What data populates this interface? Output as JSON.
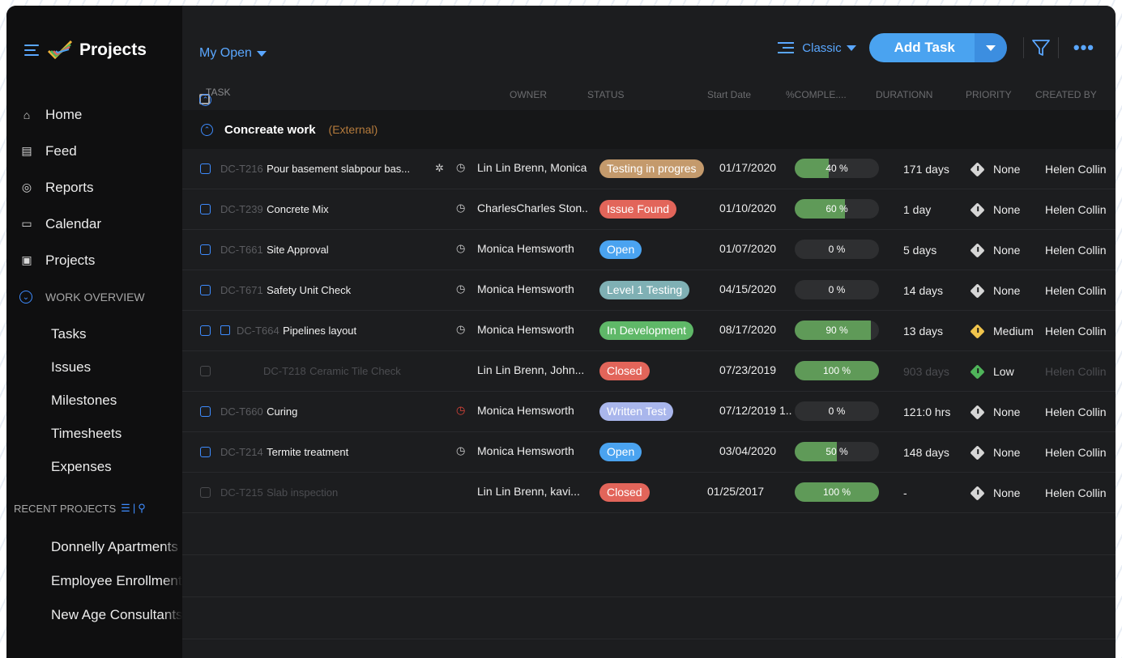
{
  "sidebar": {
    "brand": "Projects",
    "nav": [
      {
        "label": "Home",
        "icon": "home-icon"
      },
      {
        "label": "Feed",
        "icon": "feed-icon"
      },
      {
        "label": "Reports",
        "icon": "reports-icon"
      },
      {
        "label": "Calendar",
        "icon": "calendar-icon"
      },
      {
        "label": "Projects",
        "icon": "projects-icon"
      }
    ],
    "work_overview": "WORK OVERVIEW",
    "work_items": [
      "Tasks",
      "Issues",
      "Milestones",
      "Timesheets",
      "Expenses"
    ],
    "recent_projects_label": "RECENT PROJECTS",
    "recent_projects": [
      "Donnelly Apartments",
      "Employee Enrollment",
      "New Age Consultants"
    ]
  },
  "toolbar": {
    "view": "My Open",
    "layout": "Classic",
    "add_task": "Add Task"
  },
  "columns": {
    "task": "TASK",
    "owner": "OWNER",
    "status": "STATUS",
    "start_date": "Start Date",
    "complete": "%COMPLE....",
    "duration": "DURATIONN",
    "priority": "PRIORITY",
    "created_by": "CREATED BY"
  },
  "group": {
    "name": "Concreate work",
    "tag": "(External)"
  },
  "colors": {
    "accent": "#4aa3f0",
    "progress": "#5f9a58",
    "status_testing": "#c49a6c",
    "status_issue": "#e2655a",
    "status_open": "#4aa3f0",
    "status_level1": "#7fb0b4",
    "status_dev": "#5fb868",
    "status_closed": "#e2655a",
    "status_written": "#a9b6ec",
    "prio_none": "#d6d6d6",
    "prio_medium": "#f0c44c",
    "prio_low": "#4fb55a"
  },
  "rows": [
    {
      "id": "DC-T216",
      "name": "Pour basement slabpour bas...",
      "owner": "Lin Lin Brenn, Monica",
      "status": "Testing in progres",
      "status_color": "#c49a6c",
      "start": "01/17/2020",
      "pct": "40 %",
      "pct_value": 40,
      "duration": "171 days",
      "priority": "None",
      "priority_color": "#d6d6d6",
      "creator": "Helen Collin",
      "dim": false,
      "bug": true,
      "timer": "normal"
    },
    {
      "id": "DC-T239",
      "name": "Concrete Mix",
      "owner": "CharlesCharles Ston..",
      "status": "Issue Found",
      "status_color": "#e2655a",
      "start": "01/10/2020",
      "pct": "60 %",
      "pct_value": 60,
      "duration": "1 day",
      "priority": "None",
      "priority_color": "#d6d6d6",
      "creator": "Helen Collin",
      "dim": false,
      "bug": false,
      "timer": "normal"
    },
    {
      "id": "DC-T661",
      "name": "Site Approval",
      "owner": "Monica Hemsworth",
      "status": "Open",
      "status_color": "#4aa3f0",
      "start": "01/07/2020",
      "pct": "0 %",
      "pct_value": 0,
      "duration": "5 days",
      "priority": "None",
      "priority_color": "#d6d6d6",
      "creator": "Helen Collin",
      "dim": false,
      "bug": false,
      "timer": "normal"
    },
    {
      "id": "DC-T671",
      "name": "Safety Unit Check",
      "owner": "Monica Hemsworth",
      "status": "Level 1 Testing",
      "status_color": "#7fb0b4",
      "start": "04/15/2020",
      "pct": "0 %",
      "pct_value": 0,
      "duration": "14 days",
      "priority": "None",
      "priority_color": "#d6d6d6",
      "creator": "Helen Collin",
      "dim": false,
      "bug": false,
      "timer": "normal"
    },
    {
      "id": "DC-T664",
      "name": "Pipelines layout",
      "owner": "Monica Hemsworth",
      "status": "In Development",
      "status_color": "#5fb868",
      "start": "08/17/2020",
      "pct": "90 %",
      "pct_value": 90,
      "duration": "13 days",
      "priority": "Medium",
      "priority_color": "#f0c44c",
      "creator": "Helen Collin",
      "dim": false,
      "bug": false,
      "timer": "normal",
      "subtask": true
    },
    {
      "id": "DC-T218",
      "name": "Ceramic Tile Check",
      "owner": "Lin Lin Brenn, John...",
      "status": "Closed",
      "status_color": "#e2655a",
      "start": "07/23/2019",
      "pct": "100 %",
      "pct_value": 100,
      "duration": "903 days",
      "priority": "Low",
      "priority_color": "#4fb55a",
      "creator": "Helen Collin",
      "dim": true,
      "bug": false,
      "timer": "none"
    },
    {
      "id": "DC-T660",
      "name": "Curing",
      "owner": "Monica Hemsworth",
      "status": "Written Test",
      "status_color": "#a9b6ec",
      "start": "07/12/2019 1..",
      "pct": "0 %",
      "pct_value": 0,
      "duration": "121:0 hrs",
      "priority": "None",
      "priority_color": "#d6d6d6",
      "creator": "Helen Collin",
      "dim": false,
      "bug": false,
      "timer": "red"
    },
    {
      "id": "DC-T214",
      "name": "Termite treatment",
      "owner": "Monica Hemsworth",
      "status": "Open",
      "status_color": "#4aa3f0",
      "start": "03/04/2020",
      "pct": "50 %",
      "pct_value": 50,
      "duration": "148 days",
      "priority": "None",
      "priority_color": "#d6d6d6",
      "creator": "Helen Collin",
      "dim": false,
      "bug": false,
      "timer": "normal"
    },
    {
      "id": "DC-T215",
      "name": "Slab inspection",
      "owner": "Lin Lin Brenn, kavi...",
      "status": "Closed",
      "status_color": "#e2655a",
      "start": "01/25/2017",
      "pct": "100 %",
      "pct_value": 100,
      "duration": "-",
      "priority": "None",
      "priority_color": "#d6d6d6",
      "creator": "Helen Collin",
      "dim": true,
      "bug": false,
      "timer": "none"
    }
  ]
}
